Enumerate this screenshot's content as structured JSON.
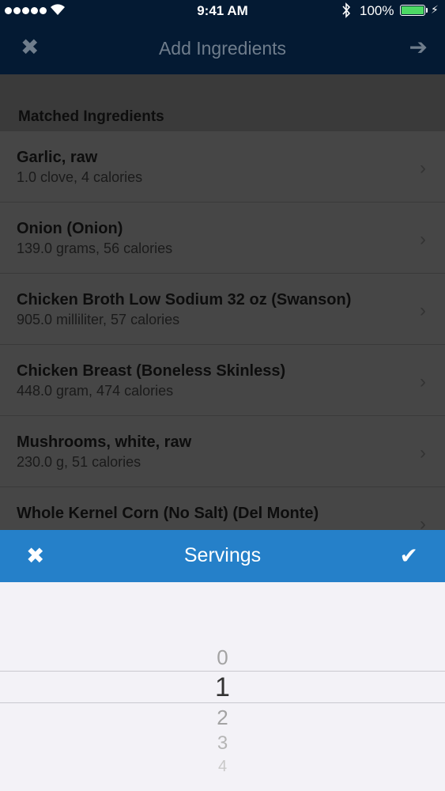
{
  "status_bar": {
    "time": "9:41 AM",
    "battery": "100%"
  },
  "nav": {
    "title": "Add Ingredients",
    "close_icon": "close-icon",
    "next_icon": "arrow-right-icon"
  },
  "section": {
    "title": "Matched Ingredients"
  },
  "ingredients": [
    {
      "name": "Garlic, raw",
      "detail": "1.0 clove, 4 calories"
    },
    {
      "name": "Onion (Onion)",
      "detail": "139.0 grams, 56 calories"
    },
    {
      "name": "Chicken Broth Low Sodium 32 oz (Swanson)",
      "detail": "905.0 milliliter, 57 calories"
    },
    {
      "name": "Chicken Breast (Boneless Skinless)",
      "detail": "448.0 gram, 474 calories"
    },
    {
      "name": "Mushrooms, white, raw",
      "detail": "230.0 g, 51 calories"
    },
    {
      "name": "Whole Kernel Corn (No Salt) (Del Monte)",
      "detail": ""
    }
  ],
  "picker_toolbar": {
    "title": "Servings",
    "cancel_icon": "close-icon",
    "done_icon": "checkmark-icon"
  },
  "picker": {
    "options": [
      "0",
      "1",
      "2",
      "3",
      "4"
    ],
    "selected": "1"
  },
  "colors": {
    "nav_bg": "#041a33",
    "accent": "#2580c9",
    "picker_bg": "#f3f2f7"
  }
}
